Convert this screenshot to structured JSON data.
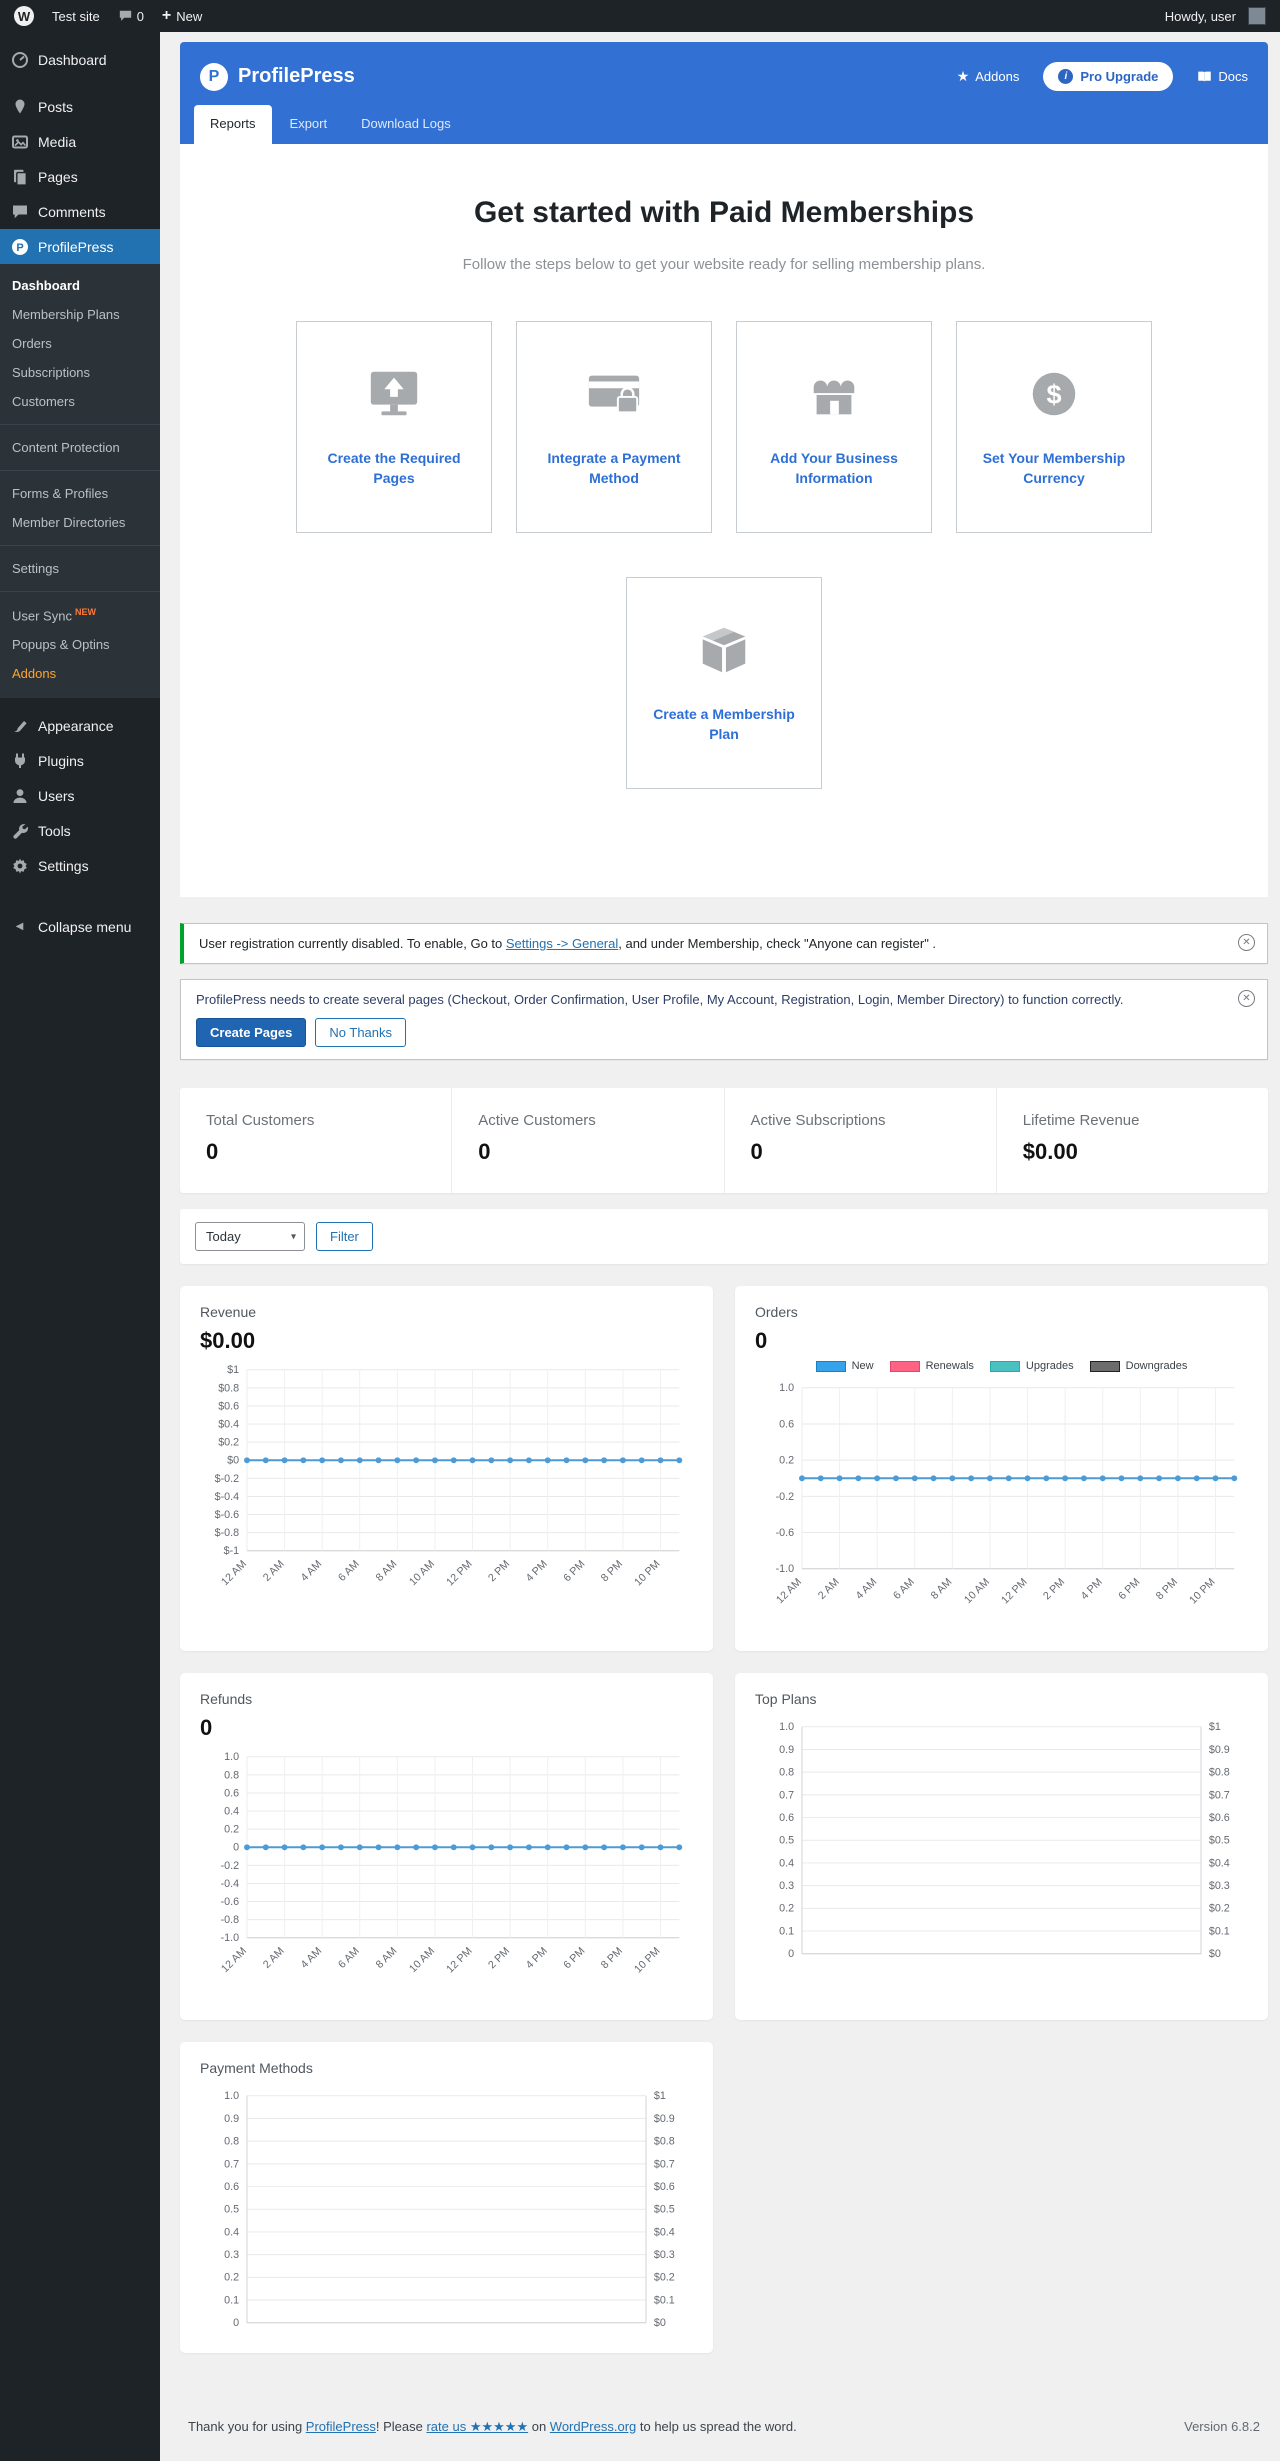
{
  "admin_bar": {
    "site_name": "Test site",
    "comments_count": "0",
    "new_label": "New",
    "howdy": "Howdy, user"
  },
  "icons": {
    "wordpress": "W",
    "profilepress_mark": "P",
    "star": "★",
    "plus": "+",
    "info": "i",
    "caret": "▾",
    "dismiss": "✕",
    "collapse_arrow": "◀",
    "dollar": "$"
  },
  "colors": {
    "admin_dark": "#1d2327",
    "submenu_bg": "#2c3338",
    "wp_accent_blue": "#2271b1",
    "pp_header_blue": "#3271d3",
    "link_blue": "#2e6fd6",
    "notice_green": "#00a32a",
    "chart_line_blue": "#4d9bd6",
    "legend_new": "#36a2eb",
    "legend_renewals": "#ff6384",
    "legend_upgrades": "#4bc0c0",
    "legend_downgrades": "#6c6c6c"
  },
  "sidebar": {
    "top": [
      {
        "label": "Dashboard"
      },
      {
        "label": "Posts"
      },
      {
        "label": "Media"
      },
      {
        "label": "Pages"
      },
      {
        "label": "Comments"
      },
      {
        "label": "ProfilePress"
      }
    ],
    "submenu": [
      {
        "label": "Dashboard",
        "current": true
      },
      {
        "label": "Membership Plans"
      },
      {
        "label": "Orders"
      },
      {
        "label": "Subscriptions"
      },
      {
        "label": "Customers"
      },
      {
        "label": "Content Protection"
      },
      {
        "label": "Forms & Profiles"
      },
      {
        "label": "Member Directories"
      },
      {
        "label": "Settings"
      },
      {
        "label": "User Sync",
        "badge": "NEW"
      },
      {
        "label": "Popups & Optins"
      },
      {
        "label": "Addons",
        "highlight": true
      }
    ],
    "new_badge": "NEW",
    "bottom": [
      {
        "label": "Appearance"
      },
      {
        "label": "Plugins"
      },
      {
        "label": "Users"
      },
      {
        "label": "Tools"
      },
      {
        "label": "Settings"
      }
    ],
    "collapse": "Collapse menu"
  },
  "header": {
    "logo_text": "ProfilePress",
    "addons_label": "Addons",
    "pro_upgrade_label": "Pro Upgrade",
    "docs_label": "Docs"
  },
  "tabs": [
    {
      "label": "Reports",
      "active": true
    },
    {
      "label": "Export",
      "active": false
    },
    {
      "label": "Download Logs",
      "active": false
    }
  ],
  "getting_started": {
    "title": "Get started with Paid Memberships",
    "subtitle": "Follow the steps below to get your website ready for selling membership plans.",
    "cards": [
      {
        "label": "Create the Required Pages",
        "icon": "monitor-upload-icon"
      },
      {
        "label": "Integrate a Payment Method",
        "icon": "credit-card-lock-icon"
      },
      {
        "label": "Add Your Business Information",
        "icon": "storefront-icon"
      },
      {
        "label": "Set Your Membership Currency",
        "icon": "dollar-circle-icon"
      },
      {
        "label": "Create a Membership Plan",
        "icon": "package-icon"
      }
    ]
  },
  "notices": [
    {
      "type": "success",
      "text_pre": "User registration currently disabled. To enable, Go to ",
      "link_text": "Settings -> General",
      "text_post": ", and under Membership, check \"Anyone can register\" ."
    },
    {
      "type": "info",
      "text": "ProfilePress needs to create several pages (Checkout, Order Confirmation, User Profile, My Account, Registration, Login, Member Directory) to function correctly.",
      "primary_button": "Create Pages",
      "secondary_button": "No Thanks"
    }
  ],
  "stats": [
    {
      "label": "Total Customers",
      "value": "0"
    },
    {
      "label": "Active Customers",
      "value": "0"
    },
    {
      "label": "Active Subscriptions",
      "value": "0"
    },
    {
      "label": "Lifetime Revenue",
      "value": "$0.00"
    }
  ],
  "filter": {
    "selected": "Today",
    "button_label": "Filter"
  },
  "chart_data": [
    {
      "id": "revenue",
      "type": "line",
      "title": "Revenue",
      "big_value": "$0.00",
      "ylim": [
        -1,
        1
      ],
      "y_tick_labels": [
        "$1",
        "$0.8",
        "$0.6",
        "$0.4",
        "$0.2",
        "$0",
        "$-0.2",
        "$-0.4",
        "$-0.6",
        "$-0.8",
        "$-1"
      ],
      "x_labels": [
        "12 AM",
        "2 AM",
        "4 AM",
        "6 AM",
        "8 AM",
        "10 AM",
        "12 PM",
        "2 PM",
        "4 PM",
        "6 PM",
        "8 PM",
        "10 PM"
      ],
      "points_per_label": 2,
      "show_points": true,
      "series": [
        {
          "name": "Revenue",
          "color": "#4d9bd6",
          "values": [
            0,
            0,
            0,
            0,
            0,
            0,
            0,
            0,
            0,
            0,
            0,
            0,
            0,
            0,
            0,
            0,
            0,
            0,
            0,
            0,
            0,
            0,
            0,
            0
          ]
        }
      ]
    },
    {
      "id": "orders",
      "type": "line",
      "title": "Orders",
      "big_value": "0",
      "legend": [
        {
          "label": "New",
          "color": "#36a2eb",
          "border": "#1b7fc4"
        },
        {
          "label": "Renewals",
          "color": "#ff6384",
          "border": "#e8436a"
        },
        {
          "label": "Upgrades",
          "color": "#4bc0c0",
          "border": "#2ba8a8"
        },
        {
          "label": "Downgrades",
          "color": "#6c6c6c",
          "border": "#222222"
        }
      ],
      "ylim": [
        -1,
        1
      ],
      "y_tick_labels": [
        "1.0",
        "0.6",
        "0.2",
        "-0.2",
        "-0.6",
        "-1.0"
      ],
      "x_labels": [
        "12 AM",
        "2 AM",
        "4 AM",
        "6 AM",
        "8 AM",
        "10 AM",
        "12 PM",
        "2 PM",
        "4 PM",
        "6 PM",
        "8 PM",
        "10 PM"
      ],
      "points_per_label": 2,
      "show_points": true,
      "series": [
        {
          "name": "New",
          "color": "#4d9bd6",
          "values": [
            0,
            0,
            0,
            0,
            0,
            0,
            0,
            0,
            0,
            0,
            0,
            0,
            0,
            0,
            0,
            0,
            0,
            0,
            0,
            0,
            0,
            0,
            0,
            0
          ]
        }
      ]
    },
    {
      "id": "refunds",
      "type": "line",
      "title": "Refunds",
      "big_value": "0",
      "ylim": [
        -1,
        1
      ],
      "y_tick_labels": [
        "1.0",
        "0.8",
        "0.6",
        "0.4",
        "0.2",
        "0",
        "-0.2",
        "-0.4",
        "-0.6",
        "-0.8",
        "-1.0"
      ],
      "x_labels": [
        "12 AM",
        "2 AM",
        "4 AM",
        "6 AM",
        "8 AM",
        "10 AM",
        "12 PM",
        "2 PM",
        "4 PM",
        "6 PM",
        "8 PM",
        "10 PM"
      ],
      "points_per_label": 2,
      "show_points": true,
      "series": [
        {
          "name": "Refunds",
          "color": "#4d9bd6",
          "values": [
            0,
            0,
            0,
            0,
            0,
            0,
            0,
            0,
            0,
            0,
            0,
            0,
            0,
            0,
            0,
            0,
            0,
            0,
            0,
            0,
            0,
            0,
            0,
            0
          ]
        }
      ]
    },
    {
      "id": "top_plans",
      "type": "line",
      "title": "Top Plans",
      "ylim": [
        0,
        1
      ],
      "y_tick_labels": [
        "1.0",
        "0.9",
        "0.8",
        "0.7",
        "0.6",
        "0.5",
        "0.4",
        "0.3",
        "0.2",
        "0.1",
        "0"
      ],
      "y_right_labels": [
        "$1",
        "$0.9",
        "$0.8",
        "$0.7",
        "$0.6",
        "$0.5",
        "$0.4",
        "$0.3",
        "$0.2",
        "$0.1",
        "$0"
      ],
      "series": []
    },
    {
      "id": "payment_methods",
      "type": "line",
      "title": "Payment Methods",
      "ylim": [
        0,
        1
      ],
      "y_tick_labels": [
        "1.0",
        "0.9",
        "0.8",
        "0.7",
        "0.6",
        "0.5",
        "0.4",
        "0.3",
        "0.2",
        "0.1",
        "0"
      ],
      "y_right_labels": [
        "$1",
        "$0.9",
        "$0.8",
        "$0.7",
        "$0.6",
        "$0.5",
        "$0.4",
        "$0.3",
        "$0.2",
        "$0.1",
        "$0"
      ],
      "series": []
    }
  ],
  "footer": {
    "pre": "Thank you for using ",
    "link1": "ProfilePress",
    "mid1": "! Please ",
    "link2": "rate us ★★★★★",
    "mid2": " on ",
    "link3": "WordPress.org",
    "post": " to help us spread the word.",
    "version": "Version 6.8.2"
  }
}
